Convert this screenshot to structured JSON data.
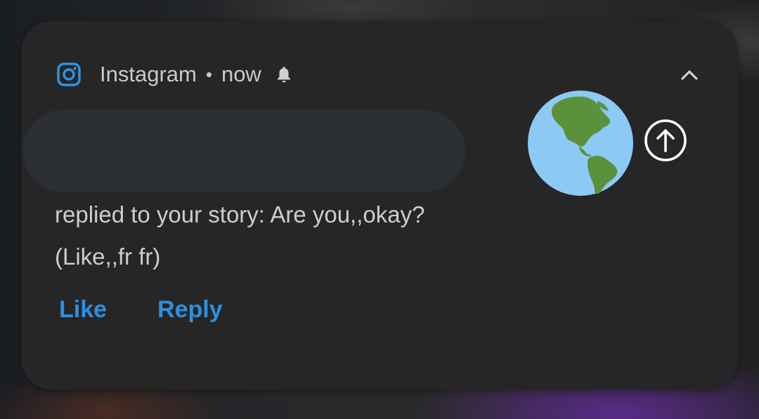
{
  "notification": {
    "app_name": "Instagram",
    "separator": "•",
    "time": "now",
    "icons": {
      "app": "instagram-icon",
      "bell": "bell-icon",
      "collapse": "chevron-up-icon",
      "attachment": "earth-globe-americas-icon",
      "expand": "arrow-up-circle-icon"
    },
    "message_line_1": "replied to your story: Are you,,okay?",
    "message_line_2": "(Like,,fr fr)",
    "actions": [
      {
        "label": "Like"
      },
      {
        "label": "Reply"
      }
    ],
    "colors": {
      "accent": "#2d8fe0",
      "card": "#262626",
      "text": "#cdcdcd"
    }
  }
}
